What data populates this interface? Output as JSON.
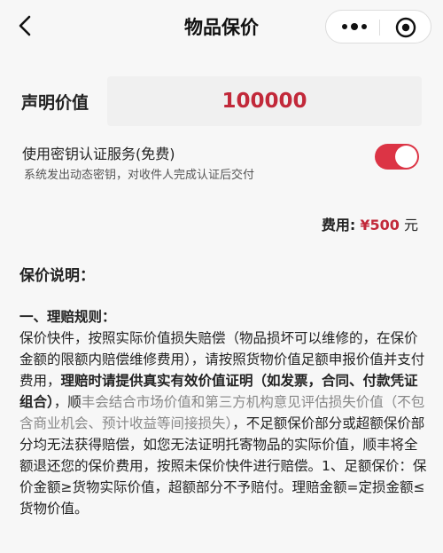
{
  "nav": {
    "title": "物品保价"
  },
  "declared": {
    "label": "声明价值",
    "value": "100000"
  },
  "service": {
    "title": "使用密钥认证服务(免费)",
    "desc": "系统发出动态密钥，对收件人完成认证后交付",
    "enabled": true,
    "toggle_color": "#dc3445"
  },
  "fee": {
    "label": "费用:",
    "amount": "¥500",
    "unit": "元"
  },
  "explain": {
    "title": "保价说明：",
    "rule_heading": "一、理赔规则：",
    "p1": "保价快件，按照实际价值损失赔偿（物品损坏可以维修的，在保价金额的限额内赔偿维修费用），请按照货物价值足额申报价值并支付费用，",
    "p2_bold": "理赔时请提供真实有效价值证明（如发票，合同、付款凭证组合）",
    "p3": "，顺",
    "p4_grey": "丰会结合市场价值和第三方机构意见评估损失价值（不包含商业机会、预计收益等间接损失）",
    "p5": "，不足额保价部分或超额保价部分均无法获得赔偿，如您无法证明托寄物品的实际价值，顺丰将全额退还您的保价费用，按照未保价快件进行赔偿。1、足额保价：保价金额≥货物实际价值，超额部分不予赔付。理赔金额=定损金额≤货物价值。"
  },
  "accent_color": "#c2293a",
  "icons": [
    "back-chevron-icon",
    "more-dots-icon",
    "close-target-icon"
  ]
}
